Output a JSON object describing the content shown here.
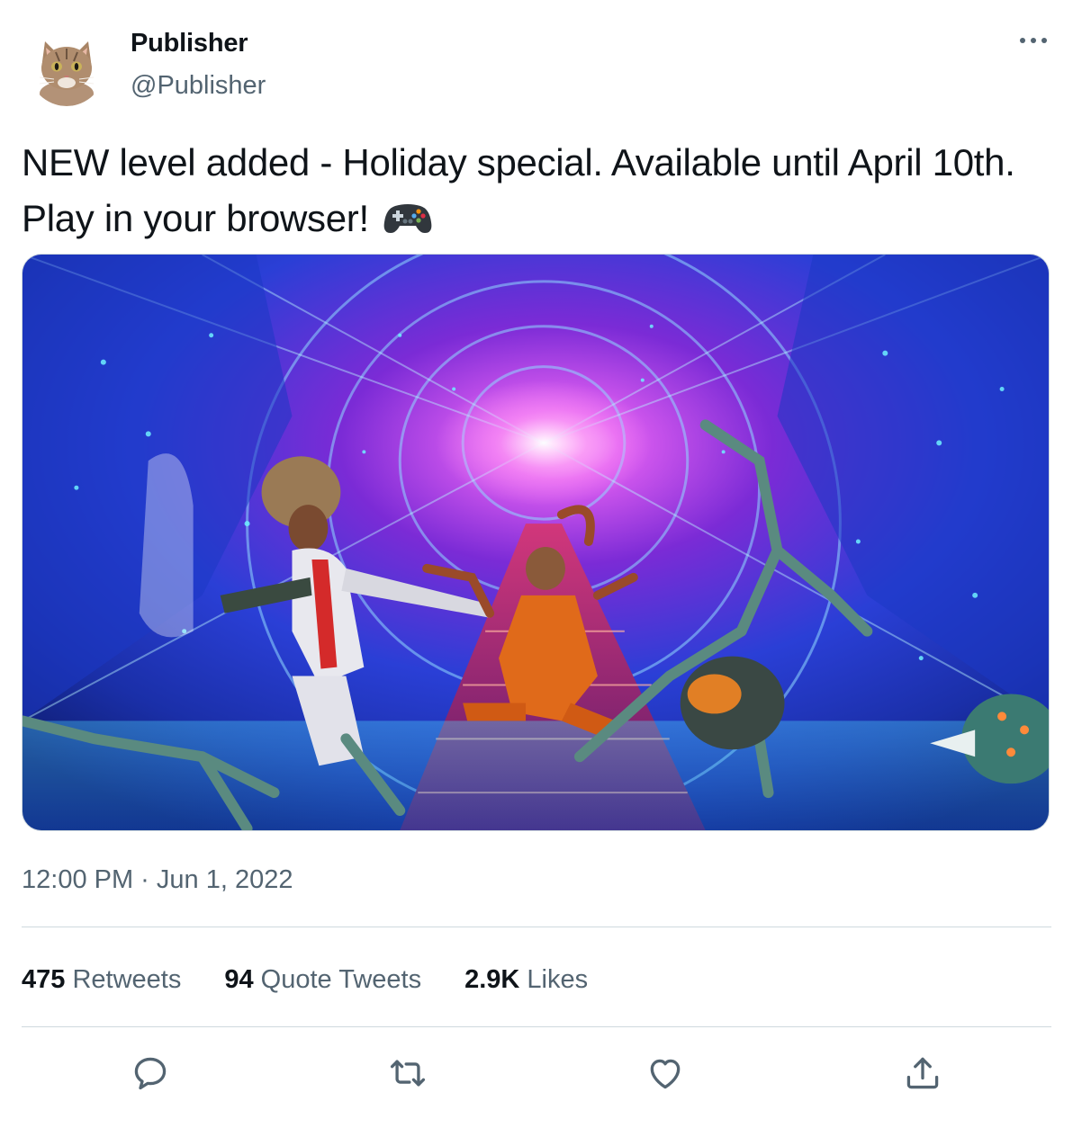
{
  "author": {
    "name": "Publisher",
    "handle": "@Publisher",
    "avatar_icon": "cat-avatar"
  },
  "tweet": {
    "text": "NEW level added - Holiday special. Available until April 10th. Play in your browser!",
    "emoji_icon": "video-game-controller-icon",
    "media_description": "sci-fi-tunnel-game-artwork"
  },
  "meta": {
    "timestamp": "12:00 PM · Jun 1, 2022"
  },
  "stats": {
    "retweets_count": "475",
    "retweets_label": "Retweets",
    "quotes_count": "94",
    "quotes_label": "Quote Tweets",
    "likes_count": "2.9K",
    "likes_label": "Likes"
  },
  "actions": {
    "reply_icon": "reply-icon",
    "retweet_icon": "retweet-icon",
    "like_icon": "heart-icon",
    "share_icon": "share-icon"
  },
  "colors": {
    "text_primary": "#0f1419",
    "text_secondary": "#536471",
    "divider": "#cfd9de"
  }
}
